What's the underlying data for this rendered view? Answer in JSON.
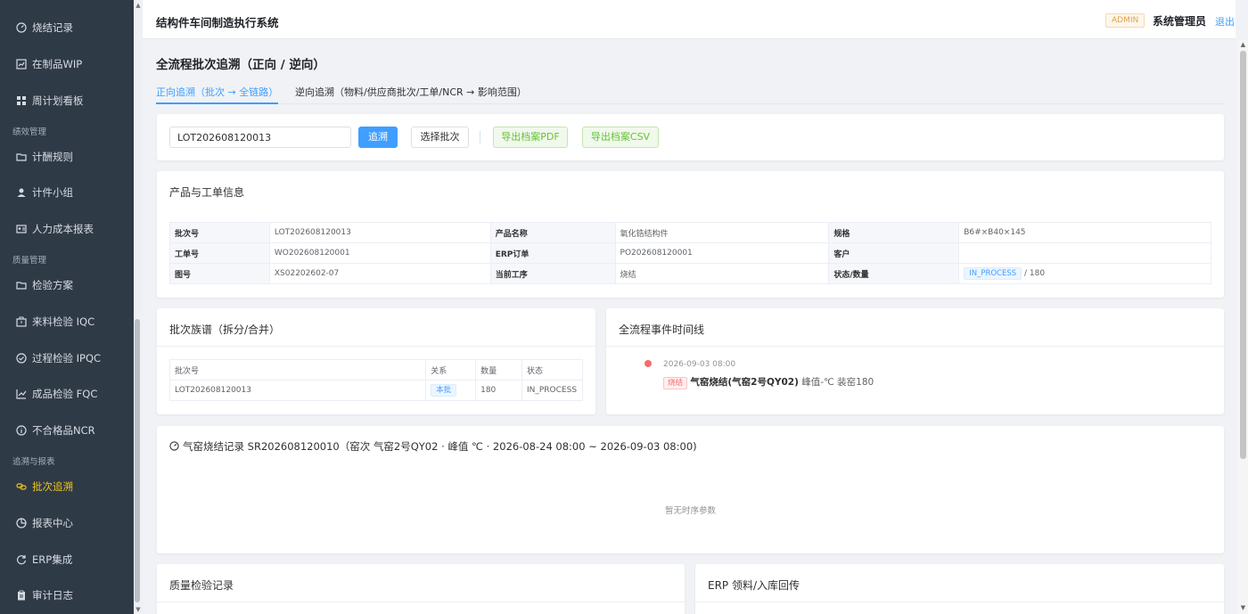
{
  "sidebar": {
    "items": [
      {
        "label": "烧结记录",
        "icon": "gauge-icon"
      },
      {
        "label": "在制品WIP",
        "icon": "chart-icon"
      },
      {
        "label": "周计划看板",
        "icon": "grid-icon"
      },
      {
        "label": "计酬规则",
        "icon": "folder-icon"
      },
      {
        "label": "计件小组",
        "icon": "user-icon"
      },
      {
        "label": "人力成本报表",
        "icon": "id-card-icon"
      },
      {
        "label": "检验方案",
        "icon": "folder-icon"
      },
      {
        "label": "来料检验 IQC",
        "icon": "box-icon"
      },
      {
        "label": "过程检验 IPQC",
        "icon": "check-circle-icon"
      },
      {
        "label": "成品检验 FQC",
        "icon": "line-chart-icon"
      },
      {
        "label": "不合格品NCR",
        "icon": "info-icon"
      },
      {
        "label": "批次追溯",
        "icon": "link-icon"
      },
      {
        "label": "报表中心",
        "icon": "pie-icon"
      },
      {
        "label": "ERP集成",
        "icon": "refresh-icon"
      },
      {
        "label": "审计日志",
        "icon": "clipboard-icon"
      }
    ],
    "groups": [
      "绩效管理",
      "质量管理",
      "追溯与报表"
    ]
  },
  "header": {
    "title": "结构件车间制造执行系统",
    "badge": "ADMIN",
    "user": "系统管理员",
    "logout": "退出"
  },
  "page": {
    "title": "全流程批次追溯（正向 / 逆向）",
    "tabs": [
      "正向追溯（批次 → 全链路）",
      "逆向追溯（物料/供应商批次/工单/NCR → 影响范围）"
    ]
  },
  "search": {
    "value": "LOT202608120013",
    "trace": "追溯",
    "select": "选择批次",
    "pdf": "导出档案PDF",
    "csv": "导出档案CSV"
  },
  "product": {
    "title": "产品与工单信息",
    "rows": [
      [
        "批次号",
        "LOT202608120013",
        "产品名称",
        "氧化锆结构件",
        "规格",
        "B6#×B40×145"
      ],
      [
        "工单号",
        "WO202608120001",
        "ERP订单",
        "PO202608120001",
        "客户",
        ""
      ],
      [
        "图号",
        "XS02202602-07",
        "当前工序",
        "烧结",
        "状态/数量",
        ""
      ]
    ],
    "status_tag": "IN_PROCESS",
    "status_qty": "/ 180"
  },
  "genealogy": {
    "title": "批次族谱（拆分/合并）",
    "headers": [
      "批次号",
      "关系",
      "数量",
      "状态"
    ],
    "row": {
      "lot": "LOT202608120013",
      "relation": "本批",
      "qty": "180",
      "status": "IN_PROCESS"
    }
  },
  "timeline": {
    "title": "全流程事件时间线",
    "time": "2026-09-03 08:00",
    "tag": "烧结",
    "event": "气窑烧结(气窑2号QY02)",
    "detail": "峰值-℃ 装窑180"
  },
  "sintering": {
    "title": "气窑烧结记录 SR202608120010（窑次 气窑2号QY02 · 峰值 ℃ · 2026-08-24 08:00 ~ 2026-09-03 08:00)",
    "empty": "暂无时序参数"
  },
  "quality": {
    "title": "质量检验记录"
  },
  "erp": {
    "title": "ERP 领料/入库回传"
  }
}
